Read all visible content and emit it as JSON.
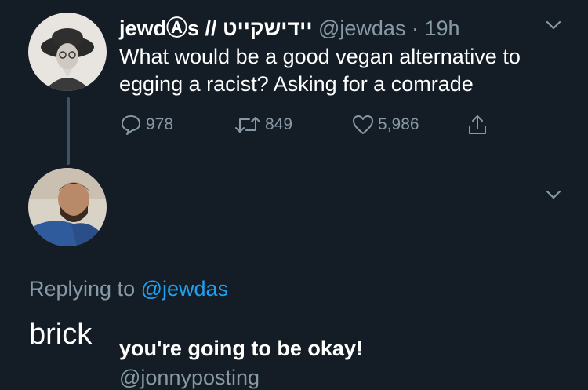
{
  "colors": {
    "background": "#141d26",
    "text_primary": "#ffffff",
    "text_secondary": "#8899a6",
    "link": "#1da1f2",
    "thread_line": "#3d5466"
  },
  "original_tweet": {
    "display_name": "jewdⒶs // יידישקייט",
    "handle": "@jewdas",
    "separator": "·",
    "time": "19h",
    "text": "What would be a good vegan alternative to egging a racist? Asking for a comrade",
    "avatar_icon": "avatar-woman-with-hat",
    "menu_icon": "chevron-down-icon",
    "actions": {
      "reply_count": "978",
      "retweet_count": "849",
      "like_count": "5,986",
      "reply_icon": "comment-bubble-icon",
      "retweet_icon": "retweet-icon",
      "like_icon": "heart-icon",
      "share_icon": "share-icon"
    }
  },
  "reply_tweet": {
    "display_name": "you're going to be okay!",
    "handle": "@jonnyposting",
    "avatar_icon": "avatar-man-with-beard",
    "menu_icon": "chevron-down-icon",
    "replying_prefix": "Replying to",
    "replying_to": "@jewdas",
    "text": "brick"
  }
}
